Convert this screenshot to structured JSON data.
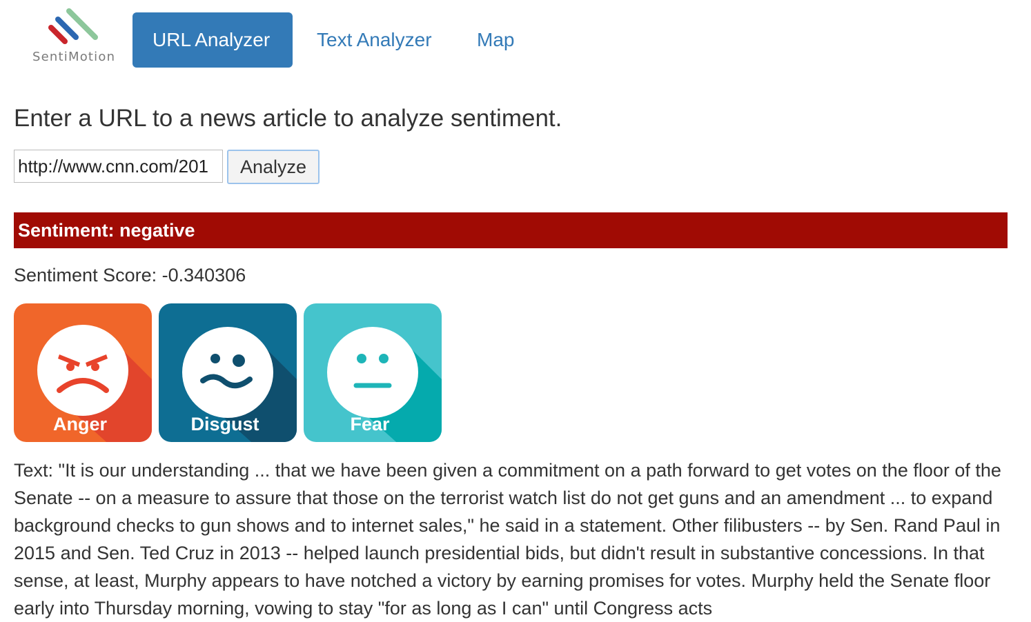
{
  "brand": {
    "name": "SentiMotion"
  },
  "nav": {
    "tabs": [
      {
        "label": "URL Analyzer",
        "active": true
      },
      {
        "label": "Text Analyzer",
        "active": false
      },
      {
        "label": "Map",
        "active": false
      }
    ]
  },
  "form": {
    "prompt": "Enter a URL to a news article to analyze sentiment.",
    "url_value": "http://www.cnn.com/201",
    "analyze_label": "Analyze"
  },
  "result": {
    "sentiment_banner": "Sentiment: negative",
    "score_text": "Sentiment Score: -0.340306",
    "emotions": [
      {
        "label": "Anger",
        "icon": "angry-face-icon",
        "color": "#f0662a"
      },
      {
        "label": "Disgust",
        "icon": "disgusted-face-icon",
        "color": "#0e6e93"
      },
      {
        "label": "Fear",
        "icon": "neutral-face-icon",
        "color": "#45c4cc"
      }
    ],
    "text": "Text: \"It is our understanding ... that we have been given a commitment on a path forward to get votes on the floor of the Senate -- on a measure to assure that those on the terrorist watch list do not get guns and an amendment ... to expand background checks to gun shows and to internet sales,\" he said in a statement. Other filibusters -- by Sen. Rand Paul in 2015 and Sen. Ted Cruz in 2013 -- helped launch presidential bids, but didn't result in substantive concessions. In that sense, at least, Murphy appears to have notched a victory by earning promises for votes. Murphy held the Senate floor early into Thursday morning, vowing to stay \"for as long as I can\" until Congress acts"
  },
  "colors": {
    "primary": "#337ab7",
    "negative_banner": "#a00b04"
  }
}
